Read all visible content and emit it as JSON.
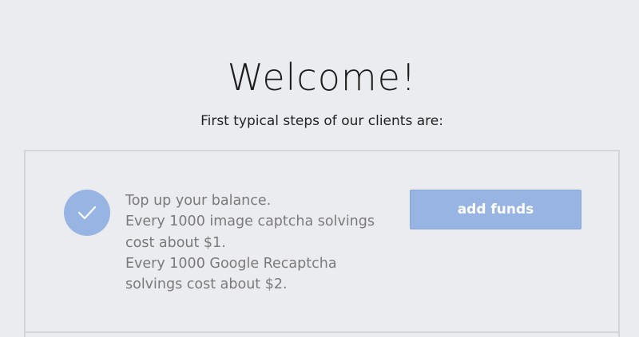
{
  "welcome": {
    "title": "Welcome!",
    "subtitle": "First typical steps of our clients are:"
  },
  "steps": [
    {
      "lines": [
        "Top up your balance.",
        "Every 1000 image captcha solvings",
        "cost about $1.",
        "Every 1000 Google Recaptcha",
        "solvings cost about $2."
      ],
      "button_label": "add funds",
      "completed_icon": "check-icon"
    }
  ],
  "colors": {
    "background": "#ebecf0",
    "accent": "#98b4e2",
    "text_muted": "#7a7a7a",
    "border": "#d3d5da"
  }
}
